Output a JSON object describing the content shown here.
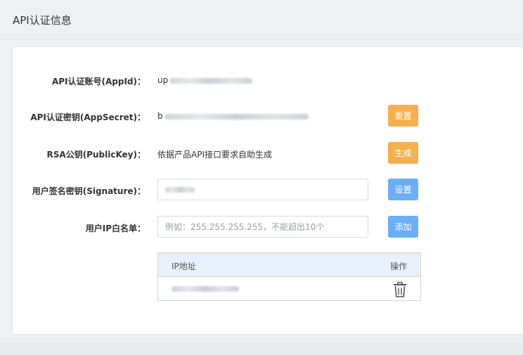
{
  "header": {
    "title": "API认证信息"
  },
  "fields": {
    "appid": {
      "label": "API认证账号(AppId)：",
      "value_prefix": "up"
    },
    "appsecret": {
      "label": "API认证密钥(AppSecret)：",
      "value_prefix": "b",
      "button": "重置"
    },
    "publickey": {
      "label": "RSA公钥(PublicKey)：",
      "value": "依据产品API接口要求自助生成",
      "button": "生成"
    },
    "signature": {
      "label": "用户签名密钥(Signature)：",
      "button": "设置"
    },
    "whitelist": {
      "label": "用户IP白名单：",
      "placeholder": "例如：255.255.255.255，不能超出10个",
      "button": "添加"
    }
  },
  "ip_table": {
    "columns": [
      "IP地址",
      "操作"
    ]
  },
  "colors": {
    "orange": "#f4b04f",
    "blue": "#6aaef5",
    "table_header": "#e8f1fb"
  }
}
